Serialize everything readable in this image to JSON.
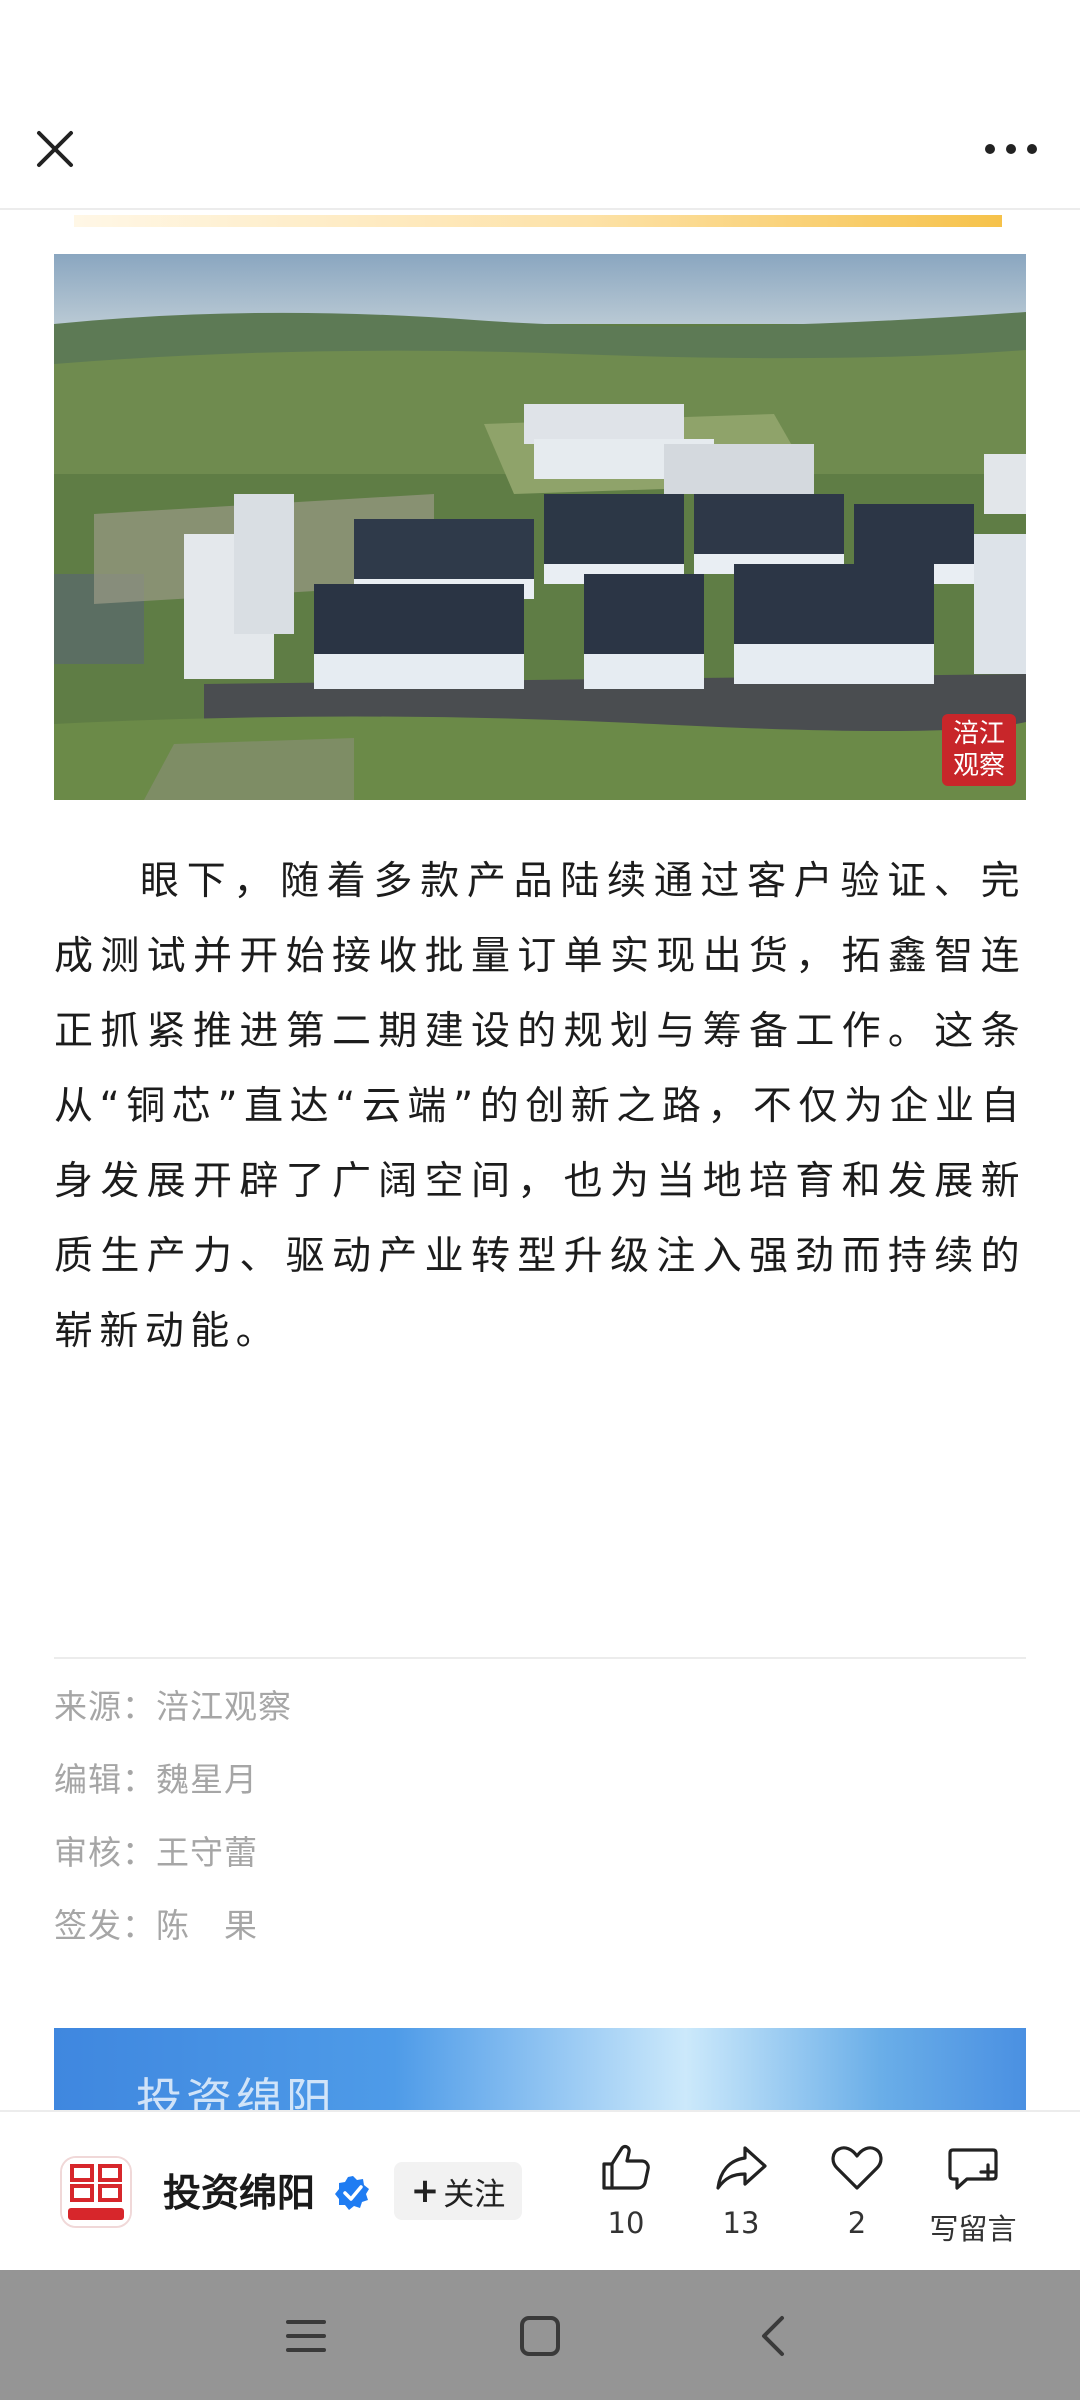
{
  "nav": {
    "close_icon": "close-icon",
    "more_icon": "more-horizontal-icon"
  },
  "photo": {
    "alt": "Aerial view of industrial park with solar-roofed factory buildings",
    "badge_line1": "涪江",
    "badge_line2": "观察"
  },
  "article": {
    "paragraph": "眼下，随着多款产品陆续通过客户验证、完成测试并开始接收批量订单实现出货，拓鑫智连正抓紧推进第二期建设的规划与筹备工作。这条从“铜芯”直达“云端”的创新之路，不仅为企业自身发展开辟了广阔空间，也为当地培育和发展新质生产力、驱动产业转型升级注入强劲而持续的崭新动能。"
  },
  "meta": {
    "source_label": "来源：",
    "source_value": "涪江观察",
    "editor_label": "编辑：",
    "editor_value": "魏星月",
    "reviewer_label": "审核：",
    "reviewer_value": "王守蕾",
    "issuer_label": "签发：",
    "issuer_value": "陈　果"
  },
  "promo": {
    "title": "投资绵阳"
  },
  "bottom_bar": {
    "account_name": "投资绵阳",
    "follow_plus": "+",
    "follow_label": "关注",
    "like_count": "10",
    "share_count": "13",
    "favorite_count": "2",
    "comment_label": "写留言"
  },
  "colors": {
    "accent_gold": "#f6c24a",
    "verified_blue": "#1f7cf2",
    "banner_blue": "#4a90e2",
    "meta_gray": "#a6a6a6",
    "nav_bar_gray": "#959595"
  }
}
